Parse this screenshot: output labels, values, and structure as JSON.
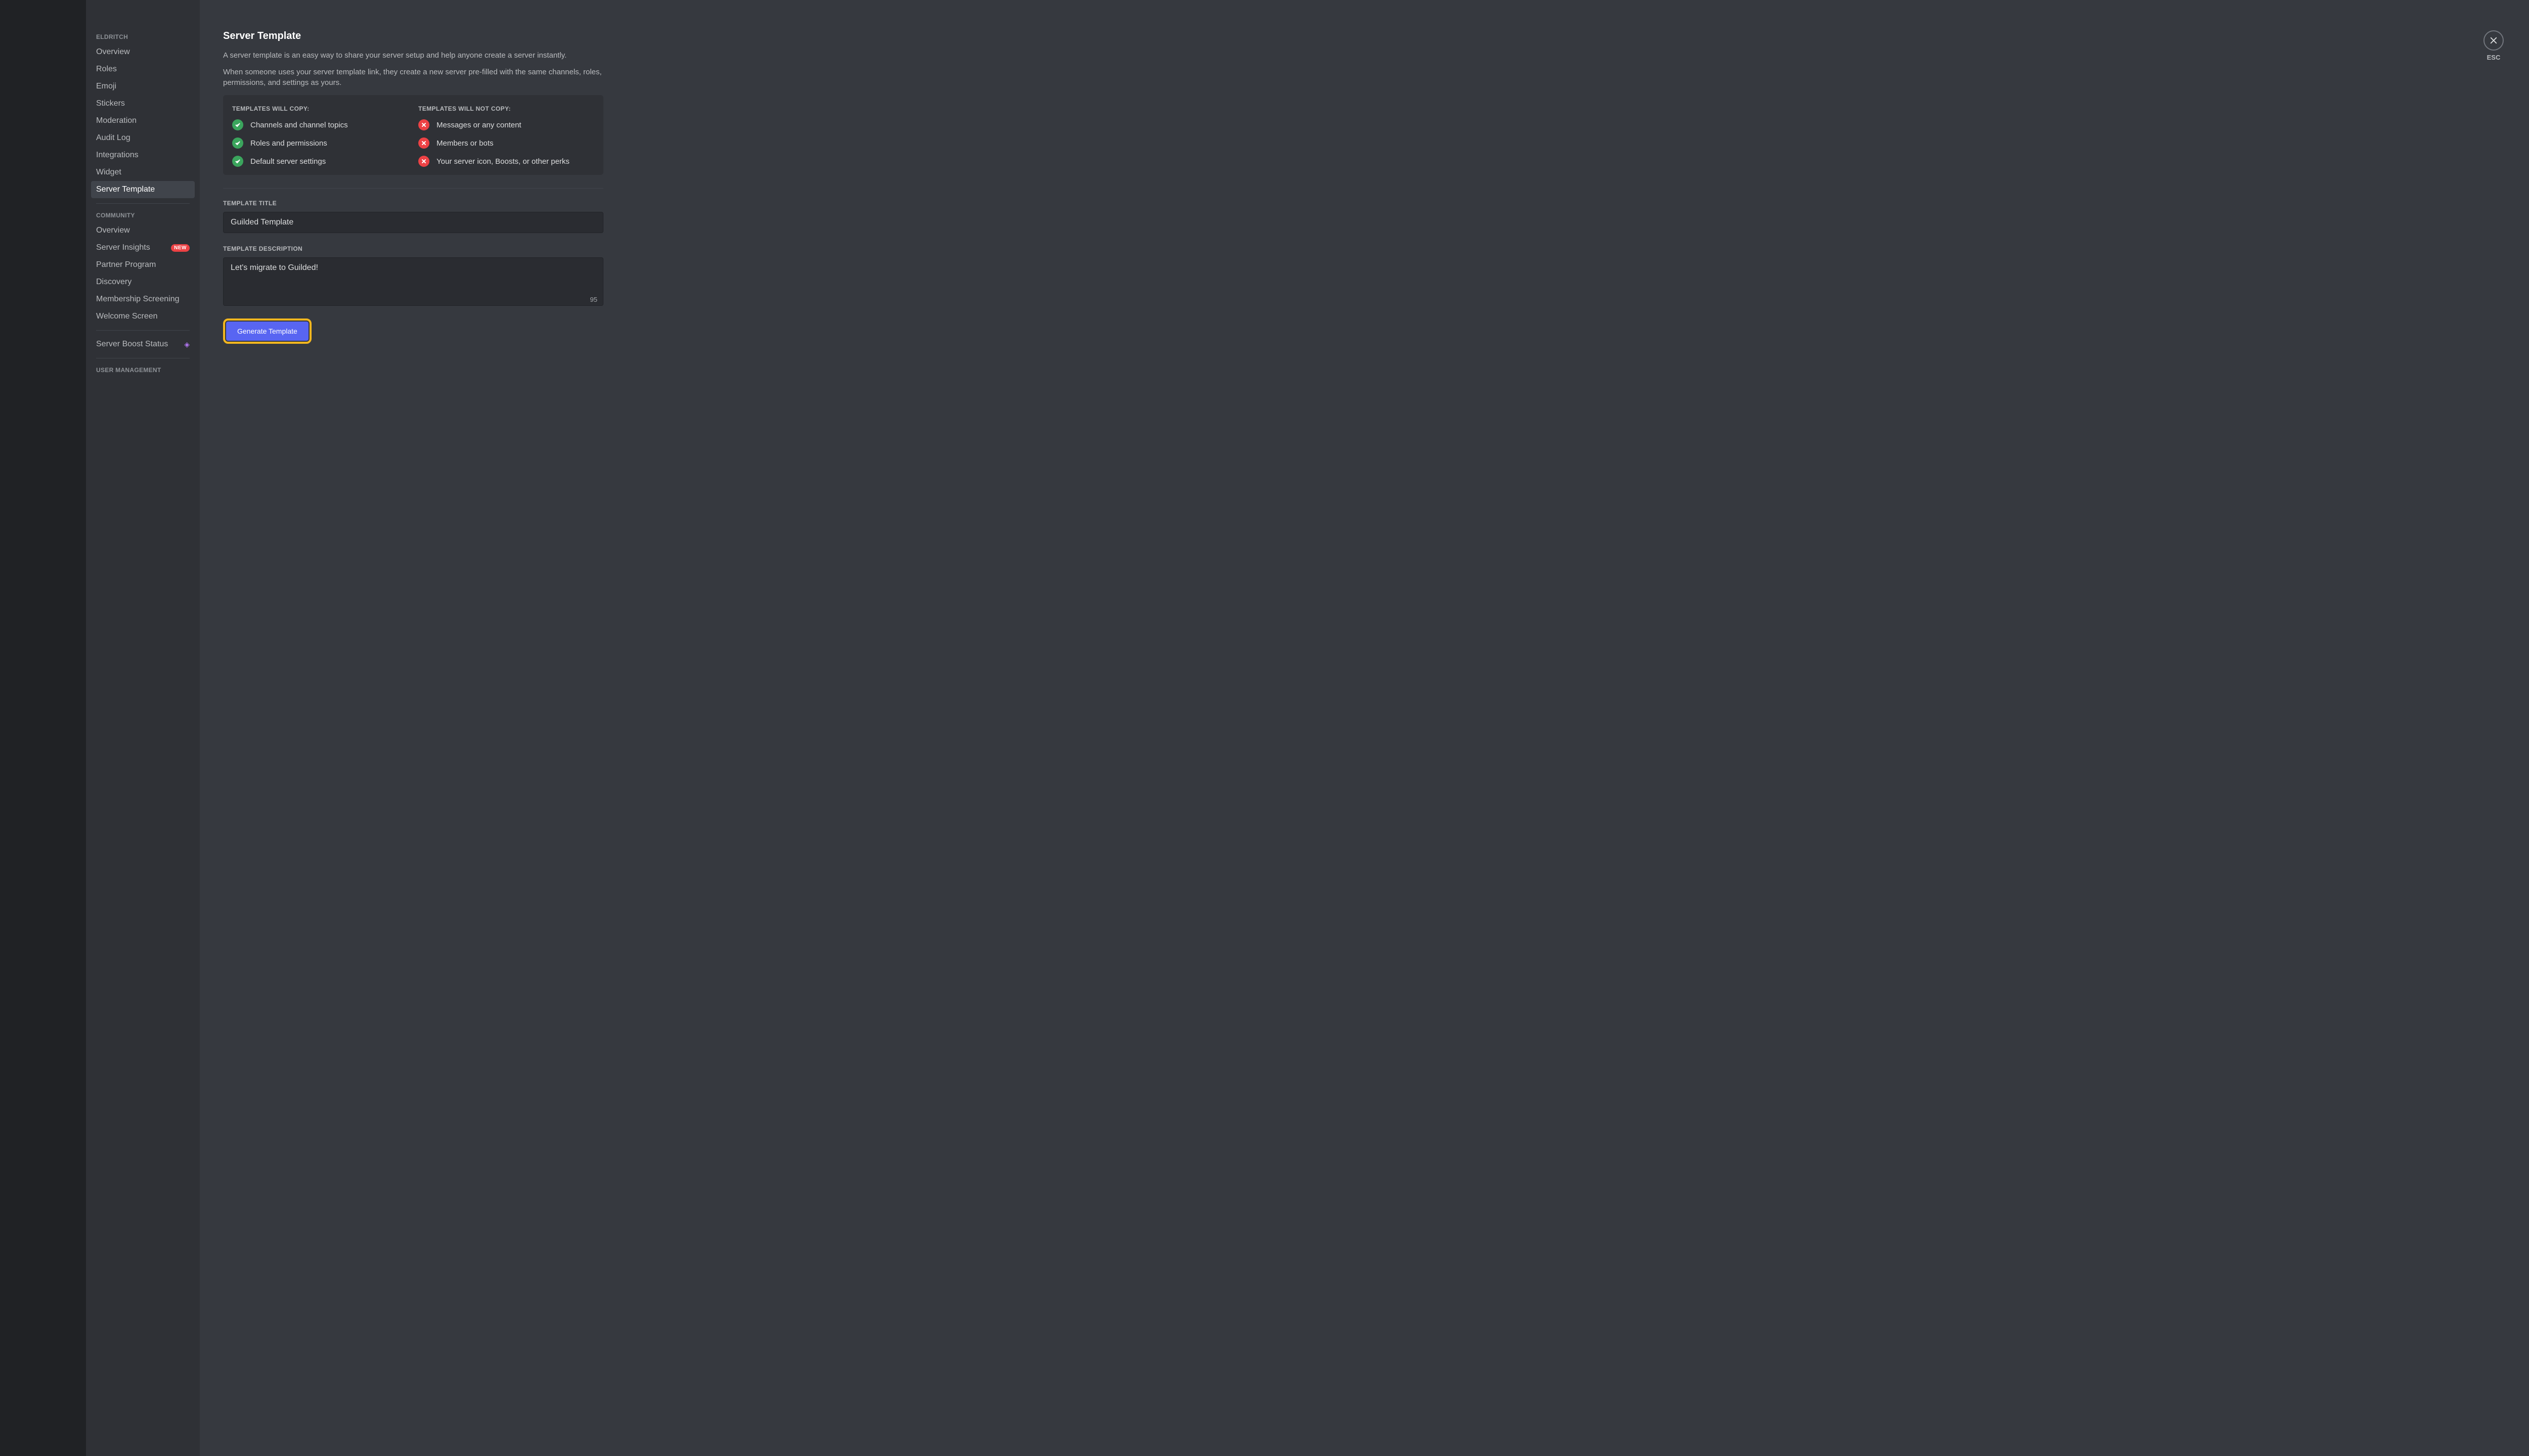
{
  "sidebar": {
    "server_name": "ELDRITCH",
    "items_a": [
      "Overview",
      "Roles",
      "Emoji",
      "Stickers",
      "Moderation",
      "Audit Log",
      "Integrations",
      "Widget",
      "Server Template"
    ],
    "community_header": "COMMUNITY",
    "items_b": [
      "Overview",
      "Server Insights",
      "Partner Program",
      "Discovery",
      "Membership Screening",
      "Welcome Screen"
    ],
    "new_badge": "NEW",
    "boost_label": "Server Boost Status",
    "user_mgmt_header": "USER MANAGEMENT"
  },
  "main": {
    "title": "Server Template",
    "desc1": "A server template is an easy way to share your server setup and help anyone create a server instantly.",
    "desc2": "When someone uses your server template link, they create a new server pre-filled with the same channels, roles, permissions, and settings as yours.",
    "will_copy_header": "TEMPLATES WILL COPY:",
    "will_copy": [
      "Channels and channel topics",
      "Roles and permissions",
      "Default server settings"
    ],
    "wont_copy_header": "TEMPLATES WILL NOT COPY:",
    "wont_copy": [
      "Messages or any content",
      "Members or bots",
      "Your server icon, Boosts, or other perks"
    ],
    "title_label": "TEMPLATE TITLE",
    "title_value": "Guilded Template",
    "desc_label": "TEMPLATE DESCRIPTION",
    "desc_value": "Let's migrate to Guilded!",
    "char_count": "95",
    "generate_btn": "Generate Template",
    "esc_label": "ESC"
  }
}
